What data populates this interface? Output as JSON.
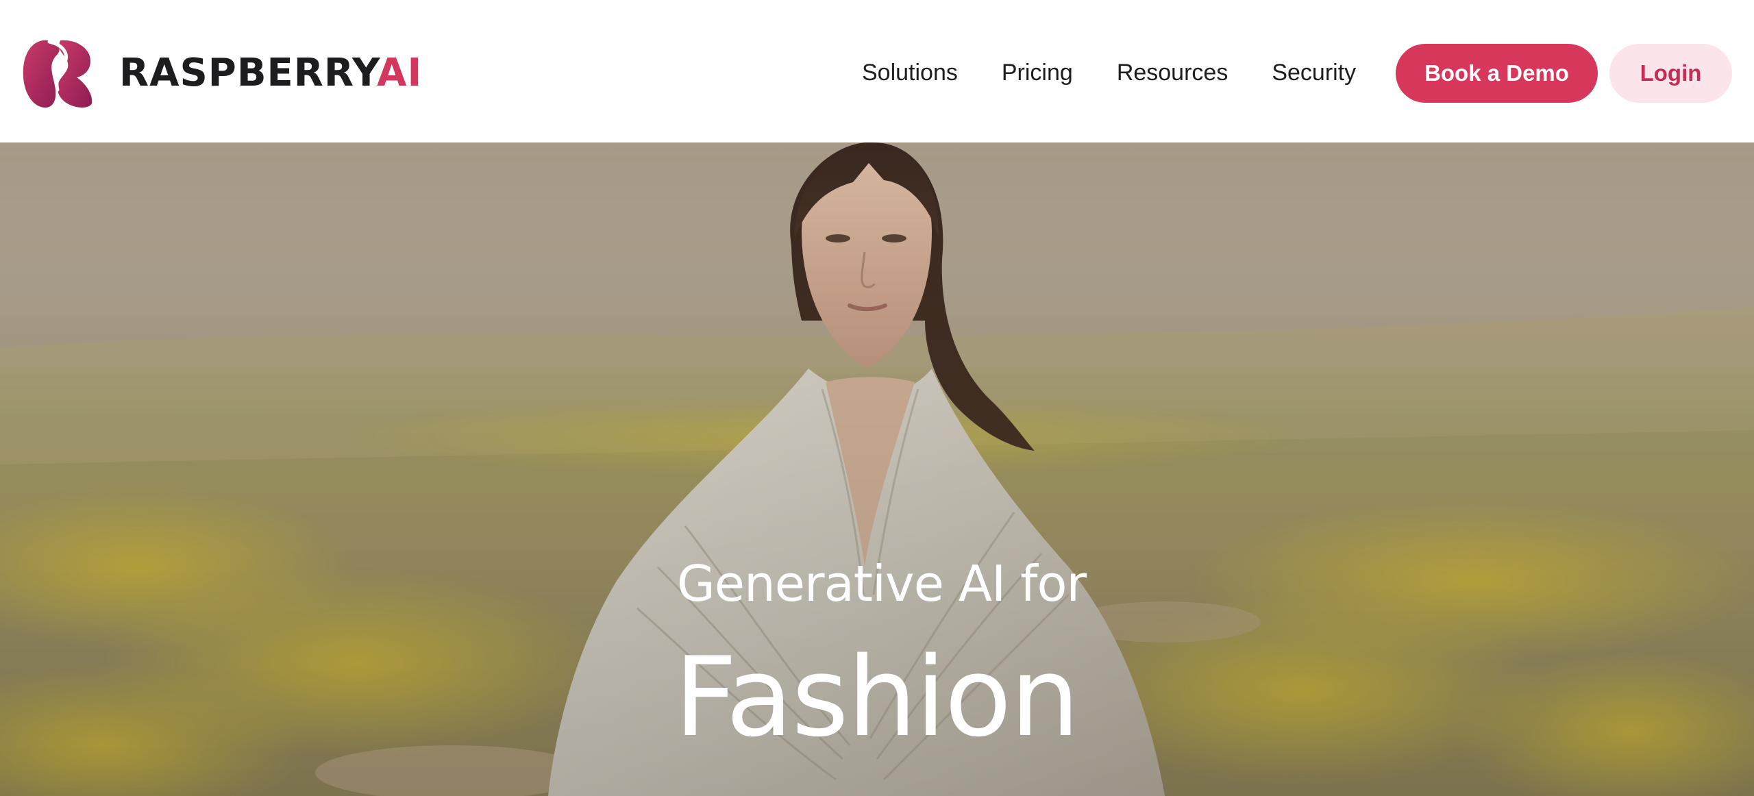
{
  "brand": {
    "name_main": "RASPBERRY",
    "name_accent": "AI",
    "logo_icon": "raspberry-r-logo-icon",
    "accent_color": "#d3375d"
  },
  "nav": {
    "items": [
      {
        "label": "Solutions"
      },
      {
        "label": "Pricing"
      },
      {
        "label": "Resources"
      },
      {
        "label": "Security"
      }
    ]
  },
  "actions": {
    "demo_label": "Book a Demo",
    "login_label": "Login",
    "demo_color": "#d8375c",
    "login_bg": "#fbe5eb"
  },
  "hero": {
    "subtitle": "Generative AI for",
    "title": "Fashion",
    "image": "model-in-white-draped-cloak-in-yellow-flower-field"
  }
}
